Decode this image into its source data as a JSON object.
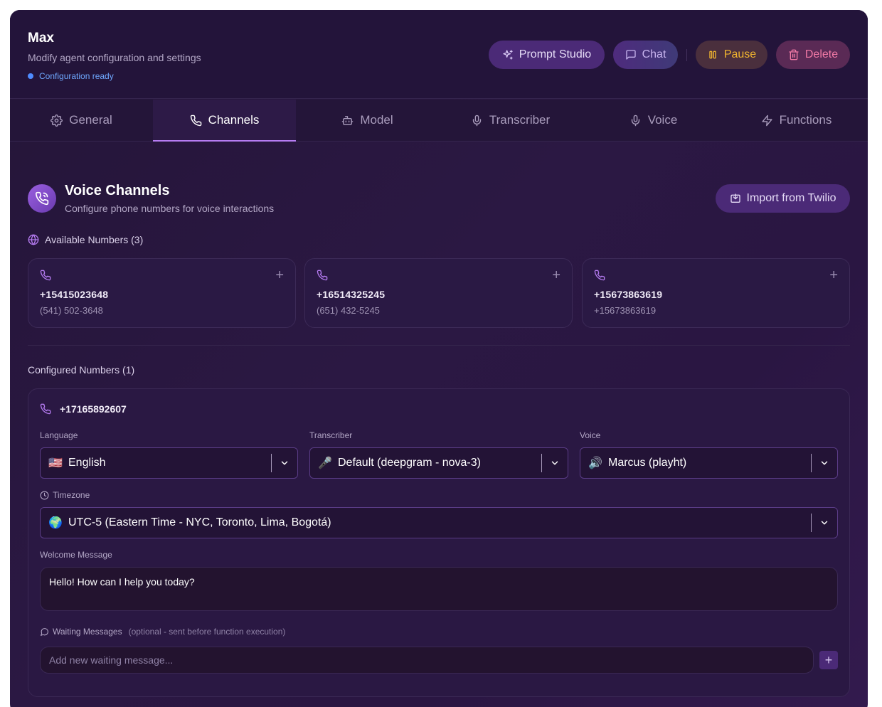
{
  "header": {
    "title": "Max",
    "subtitle": "Modify agent configuration and settings",
    "status": "Configuration ready",
    "buttons": {
      "prompt_studio": "Prompt Studio",
      "chat": "Chat",
      "pause": "Pause",
      "delete": "Delete"
    }
  },
  "tabs": [
    {
      "label": "General",
      "icon": "gear-icon"
    },
    {
      "label": "Channels",
      "icon": "phone-icon"
    },
    {
      "label": "Model",
      "icon": "bot-icon"
    },
    {
      "label": "Transcriber",
      "icon": "mic-icon"
    },
    {
      "label": "Voice",
      "icon": "mic-icon"
    },
    {
      "label": "Functions",
      "icon": "bolt-icon"
    }
  ],
  "active_tab": "Channels",
  "section": {
    "title": "Voice Channels",
    "subtitle": "Configure phone numbers for voice interactions",
    "import_button": "Import from Twilio"
  },
  "available": {
    "title": "Available Numbers (3)",
    "numbers": [
      {
        "number": "+15415023648",
        "formatted": "(541) 502-3648"
      },
      {
        "number": "+16514325245",
        "formatted": "(651) 432-5245"
      },
      {
        "number": "+15673863619",
        "formatted": "+15673863619"
      }
    ]
  },
  "configured": {
    "title": "Configured Numbers (1)",
    "number": "+17165892607",
    "language": {
      "label": "Language",
      "flag": "🇺🇸",
      "value": "English"
    },
    "transcriber": {
      "label": "Transcriber",
      "icon": "🎤",
      "value": "Default (deepgram - nova-3)"
    },
    "voice": {
      "label": "Voice",
      "icon": "🔊",
      "value": "Marcus (playht)"
    },
    "timezone": {
      "label": "Timezone",
      "icon": "🌍",
      "value": "UTC-5 (Eastern Time - NYC, Toronto, Lima, Bogotá)"
    },
    "welcome": {
      "label": "Welcome Message",
      "value": "Hello! How can I help you today?"
    },
    "waiting": {
      "label": "Waiting Messages",
      "hint": "(optional - sent before function execution)",
      "placeholder": "Add new waiting message...",
      "add_label": "+"
    }
  },
  "colors": {
    "accent": "#b67cf2",
    "pause": "#f1b52f",
    "delete": "#f27aa6",
    "status": "#4f8cff"
  }
}
